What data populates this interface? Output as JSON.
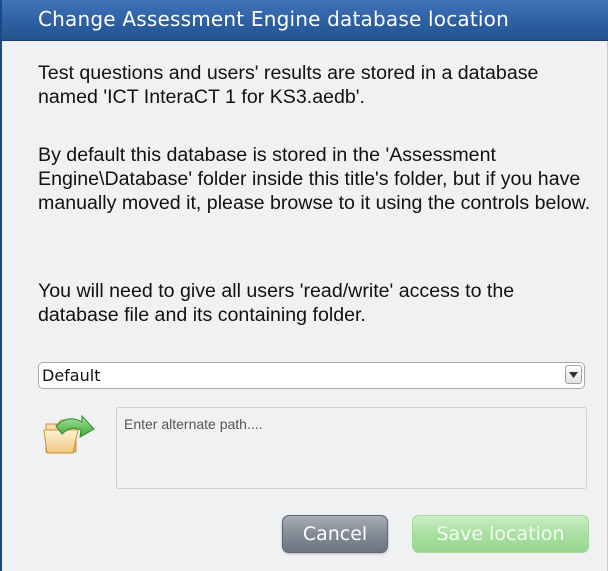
{
  "dialog": {
    "title": "Change Assessment Engine database location",
    "paragraphs": [
      "Test questions and users' results are stored in a database named 'ICT InteraCT 1 for KS3.aedb'.",
      "By default this database is stored in the 'Assessment Engine\\Database' folder inside this title's folder, but if you have manually moved it, please browse to it using the controls below.",
      "You will need to give all users 'read/write' access to the database file and its containing folder."
    ],
    "location_select": {
      "selected": "Default"
    },
    "browse_icon": "folder-open-icon",
    "path_input": {
      "placeholder": "Enter alternate path....",
      "value": ""
    },
    "buttons": {
      "cancel_label": "Cancel",
      "save_label": "Save location"
    }
  },
  "colors": {
    "titlebar": "#2d5fa3",
    "cancel_button": "#838b96",
    "save_button_disabled": "#a9e0a2"
  }
}
